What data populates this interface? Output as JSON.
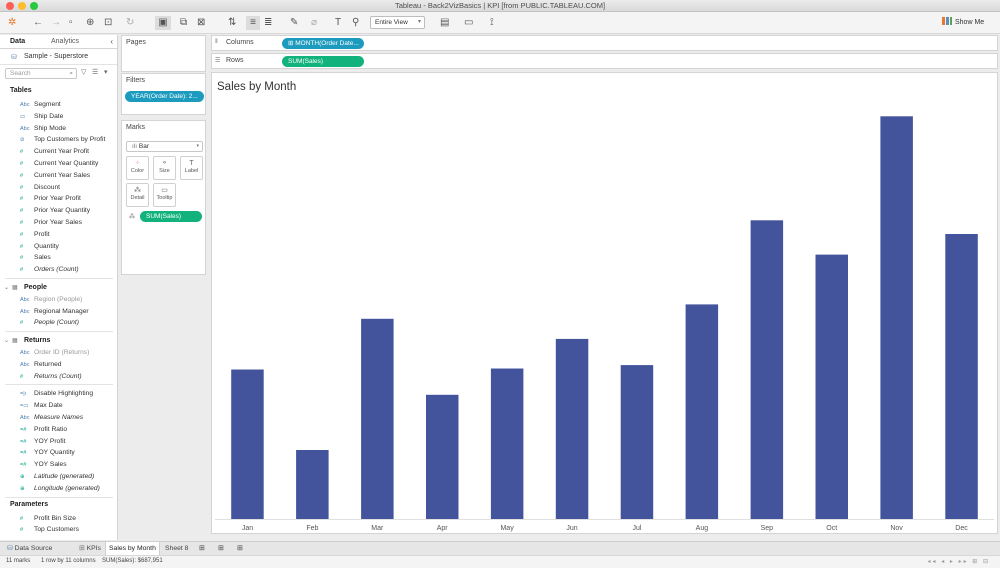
{
  "window": {
    "title": "Tableau - Back2VizBasics | KPI [from PUBLIC.TABLEAU.COM]"
  },
  "toolbar": {
    "fit_label": "Entire View",
    "show_me_label": "Show Me"
  },
  "data_pane": {
    "tab_data": "Data",
    "tab_analytics": "Analytics",
    "datasource": "Sample - Superstore",
    "search_placeholder": "Search",
    "tables_header": "Tables",
    "orders_fields": [
      {
        "icon": "Abc",
        "label": "Segment",
        "kind": "dim"
      },
      {
        "icon": "▭",
        "label": "Ship Date",
        "kind": "dim"
      },
      {
        "icon": "Abc",
        "label": "Ship Mode",
        "kind": "dim"
      },
      {
        "icon": "⊘",
        "label": "Top Customers by Profit",
        "kind": "dim"
      },
      {
        "icon": "#",
        "label": "Current Year Profit",
        "kind": "mea"
      },
      {
        "icon": "#",
        "label": "Current Year Quantity",
        "kind": "mea"
      },
      {
        "icon": "#",
        "label": "Current Year Sales",
        "kind": "mea"
      },
      {
        "icon": "#",
        "label": "Discount",
        "kind": "mea"
      },
      {
        "icon": "#",
        "label": "Prior Year Profit",
        "kind": "mea"
      },
      {
        "icon": "#",
        "label": "Prior Year Quantity",
        "kind": "mea"
      },
      {
        "icon": "#",
        "label": "Prior Year Sales",
        "kind": "mea"
      },
      {
        "icon": "#",
        "label": "Profit",
        "kind": "mea"
      },
      {
        "icon": "#",
        "label": "Quantity",
        "kind": "mea"
      },
      {
        "icon": "#",
        "label": "Sales",
        "kind": "mea"
      },
      {
        "icon": "#",
        "label": "Orders (Count)",
        "kind": "mea",
        "italic": true
      }
    ],
    "people_folder": "People",
    "people_fields": [
      {
        "icon": "Abc",
        "label": "Region (People)",
        "kind": "dim",
        "greyed": true
      },
      {
        "icon": "Abc",
        "label": "Regional Manager",
        "kind": "dim"
      },
      {
        "icon": "#",
        "label": "People (Count)",
        "kind": "mea",
        "italic": true
      }
    ],
    "returns_folder": "Returns",
    "returns_fields": [
      {
        "icon": "Abc",
        "label": "Order ID (Returns)",
        "kind": "dim",
        "greyed": true
      },
      {
        "icon": "Abc",
        "label": "Returned",
        "kind": "dim"
      },
      {
        "icon": "#",
        "label": "Returns (Count)",
        "kind": "mea",
        "italic": true
      }
    ],
    "calc_fields": [
      {
        "icon": "=|ı",
        "label": "Disable Highlighting",
        "kind": "dim"
      },
      {
        "icon": "=▭",
        "label": "Max Date",
        "kind": "dim"
      },
      {
        "icon": "Abc",
        "label": "Measure Names",
        "kind": "dim",
        "italic": true
      },
      {
        "icon": "=#",
        "label": "Profit Ratio",
        "kind": "mea"
      },
      {
        "icon": "=#",
        "label": "YOY Profit",
        "kind": "mea"
      },
      {
        "icon": "=#",
        "label": "YOY Quantity",
        "kind": "mea"
      },
      {
        "icon": "=#",
        "label": "YOY Sales",
        "kind": "mea"
      },
      {
        "icon": "⊕",
        "label": "Latitude (generated)",
        "kind": "mea",
        "italic": true
      },
      {
        "icon": "⊕",
        "label": "Longitude (generated)",
        "kind": "mea",
        "italic": true
      }
    ],
    "parameters_header": "Parameters",
    "parameters": [
      {
        "icon": "#",
        "label": "Profit Bin Size",
        "kind": "mea"
      },
      {
        "icon": "#",
        "label": "Top Customers",
        "kind": "mea"
      }
    ]
  },
  "cards": {
    "pages_title": "Pages",
    "filters_title": "Filters",
    "filter_pill": "YEAR(Order Date): 2...",
    "marks_title": "Marks",
    "mark_type": "Bar",
    "mark_buttons": [
      "Color",
      "Size",
      "Label",
      "Detail",
      "Tooltip"
    ],
    "marks_pill": "SUM(Sales)"
  },
  "shelves": {
    "columns_label": "Columns",
    "columns_pill": "MONTH(Order Date...",
    "rows_label": "Rows",
    "rows_pill": "SUM(Sales)"
  },
  "viz": {
    "title": "Sales by Month"
  },
  "chart_data": {
    "type": "bar",
    "title": "Sales by Month",
    "categories": [
      "Jan",
      "Feb",
      "Mar",
      "Apr",
      "May",
      "Jun",
      "Jul",
      "Aug",
      "Sep",
      "Oct",
      "Nov",
      "Dec"
    ],
    "values": [
      43971,
      20301,
      58872,
      36522,
      44261,
      52982,
      45264,
      63121,
      87867,
      77777,
      118448,
      83829
    ],
    "ylim": [
      0,
      120000
    ],
    "bar_color": "#44549c",
    "grid": false
  },
  "bottom_tabs": {
    "data_source": "Data Source",
    "sheets": [
      "KPIs",
      "Sales by Month",
      "Sheet 8"
    ],
    "active": "Sales by Month"
  },
  "status": {
    "marks": "11 marks",
    "dims": "1 row by 11 columns",
    "sum": "SUM(Sales): $687,951"
  }
}
